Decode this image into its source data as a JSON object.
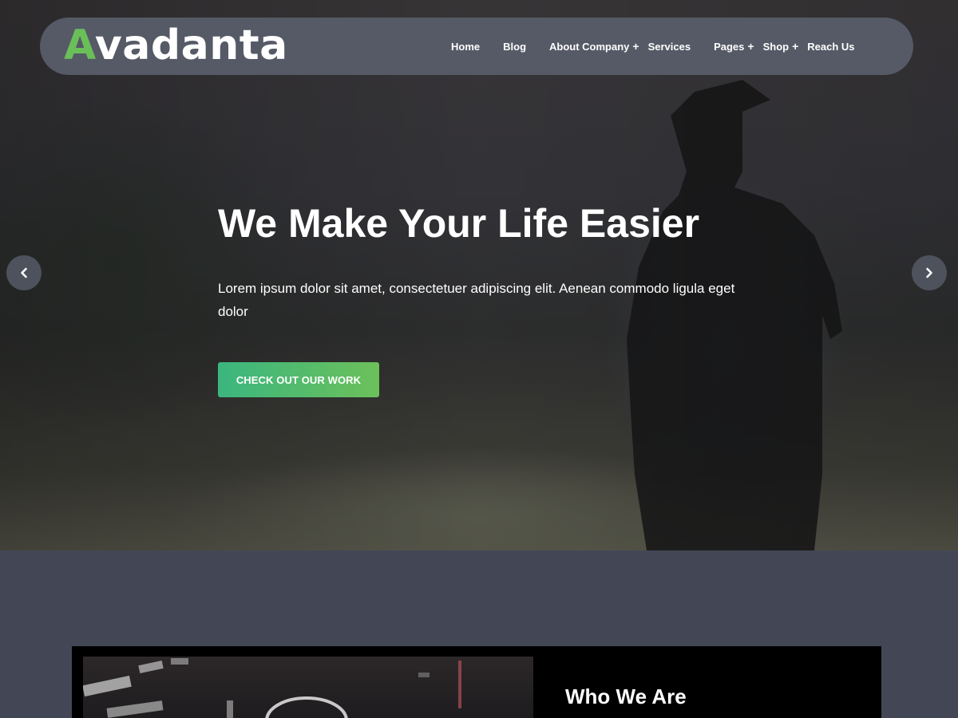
{
  "brand": {
    "logo_first_letter": "A",
    "logo_rest": "vadanta",
    "accent_color": "#6bbf59"
  },
  "nav": {
    "items": [
      {
        "label": "Home",
        "has_submenu": false
      },
      {
        "label": "Blog",
        "has_submenu": false
      },
      {
        "label": "About Company",
        "has_submenu": true
      },
      {
        "label": "Services",
        "has_submenu": false
      },
      {
        "label": "Pages",
        "has_submenu": true
      },
      {
        "label": "Shop",
        "has_submenu": true
      },
      {
        "label": "Reach Us",
        "has_submenu": false
      }
    ],
    "submenu_icon": "+"
  },
  "hero": {
    "title": "We Make Your Life Easier",
    "text": "Lorem ipsum dolor sit amet, consectetuer adipiscing elit. Aenean commodo ligula eget dolor",
    "cta_label": "CHECK OUT OUR WORK",
    "prev_icon": "chevron-left-icon",
    "next_icon": "chevron-right-icon"
  },
  "about": {
    "title": "Who We Are"
  },
  "colors": {
    "navbar_bg": "#555a66",
    "section_bg": "#434755",
    "cta_gradient_start": "#3bb67f",
    "cta_gradient_end": "#6cc05a"
  }
}
